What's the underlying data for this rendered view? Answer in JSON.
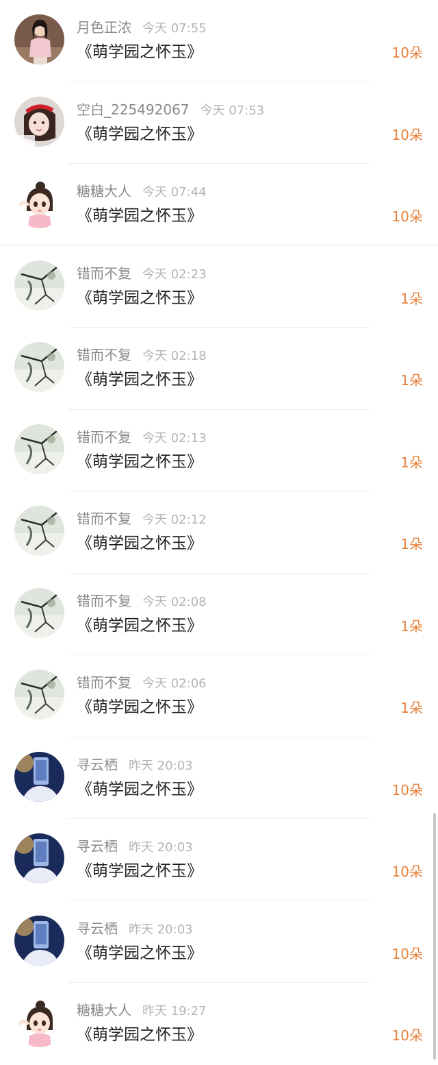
{
  "items": [
    {
      "name": "月色正浓",
      "time": "今天 07:55",
      "book": "《萌学园之怀玉》",
      "gift": "10朵",
      "avatar": "girl-photo-avatar"
    },
    {
      "name": "空白_225492067",
      "time": "今天 07:53",
      "book": "《萌学园之怀玉》",
      "gift": "10朵",
      "avatar": "red-headband-avatar"
    },
    {
      "name": "糖糖大人",
      "time": "今天 07:44",
      "book": "《萌学园之怀玉》",
      "gift": "10朵",
      "avatar": "cartoon-girl-avatar"
    },
    {
      "name": "错而不复",
      "time": "今天 02:23",
      "book": "《萌学园之怀玉》",
      "gift": "1朵",
      "avatar": "ink-painting-avatar"
    },
    {
      "name": "错而不复",
      "time": "今天 02:18",
      "book": "《萌学园之怀玉》",
      "gift": "1朵",
      "avatar": "ink-painting-avatar"
    },
    {
      "name": "错而不复",
      "time": "今天 02:13",
      "book": "《萌学园之怀玉》",
      "gift": "1朵",
      "avatar": "ink-painting-avatar"
    },
    {
      "name": "错而不复",
      "time": "今天 02:12",
      "book": "《萌学园之怀玉》",
      "gift": "1朵",
      "avatar": "ink-painting-avatar"
    },
    {
      "name": "错而不复",
      "time": "今天 02:08",
      "book": "《萌学园之怀玉》",
      "gift": "1朵",
      "avatar": "ink-painting-avatar"
    },
    {
      "name": "错而不复",
      "time": "今天 02:06",
      "book": "《萌学园之怀玉》",
      "gift": "1朵",
      "avatar": "ink-painting-avatar"
    },
    {
      "name": "寻云栖",
      "time": "昨天 20:03",
      "book": "《萌学园之怀玉》",
      "gift": "10朵",
      "avatar": "blue-photo-avatar"
    },
    {
      "name": "寻云栖",
      "time": "昨天 20:03",
      "book": "《萌学园之怀玉》",
      "gift": "10朵",
      "avatar": "blue-photo-avatar"
    },
    {
      "name": "寻云栖",
      "time": "昨天 20:03",
      "book": "《萌学园之怀玉》",
      "gift": "10朵",
      "avatar": "blue-photo-avatar"
    },
    {
      "name": "糖糖大人",
      "time": "昨天 19:27",
      "book": "《萌学园之怀玉》",
      "gift": "10朵",
      "avatar": "cartoon-girl-avatar"
    }
  ],
  "colors": {
    "gift": "#e8823a",
    "name": "#8a8a8a",
    "time": "#b4b4b4",
    "book": "#1f1f1f"
  }
}
